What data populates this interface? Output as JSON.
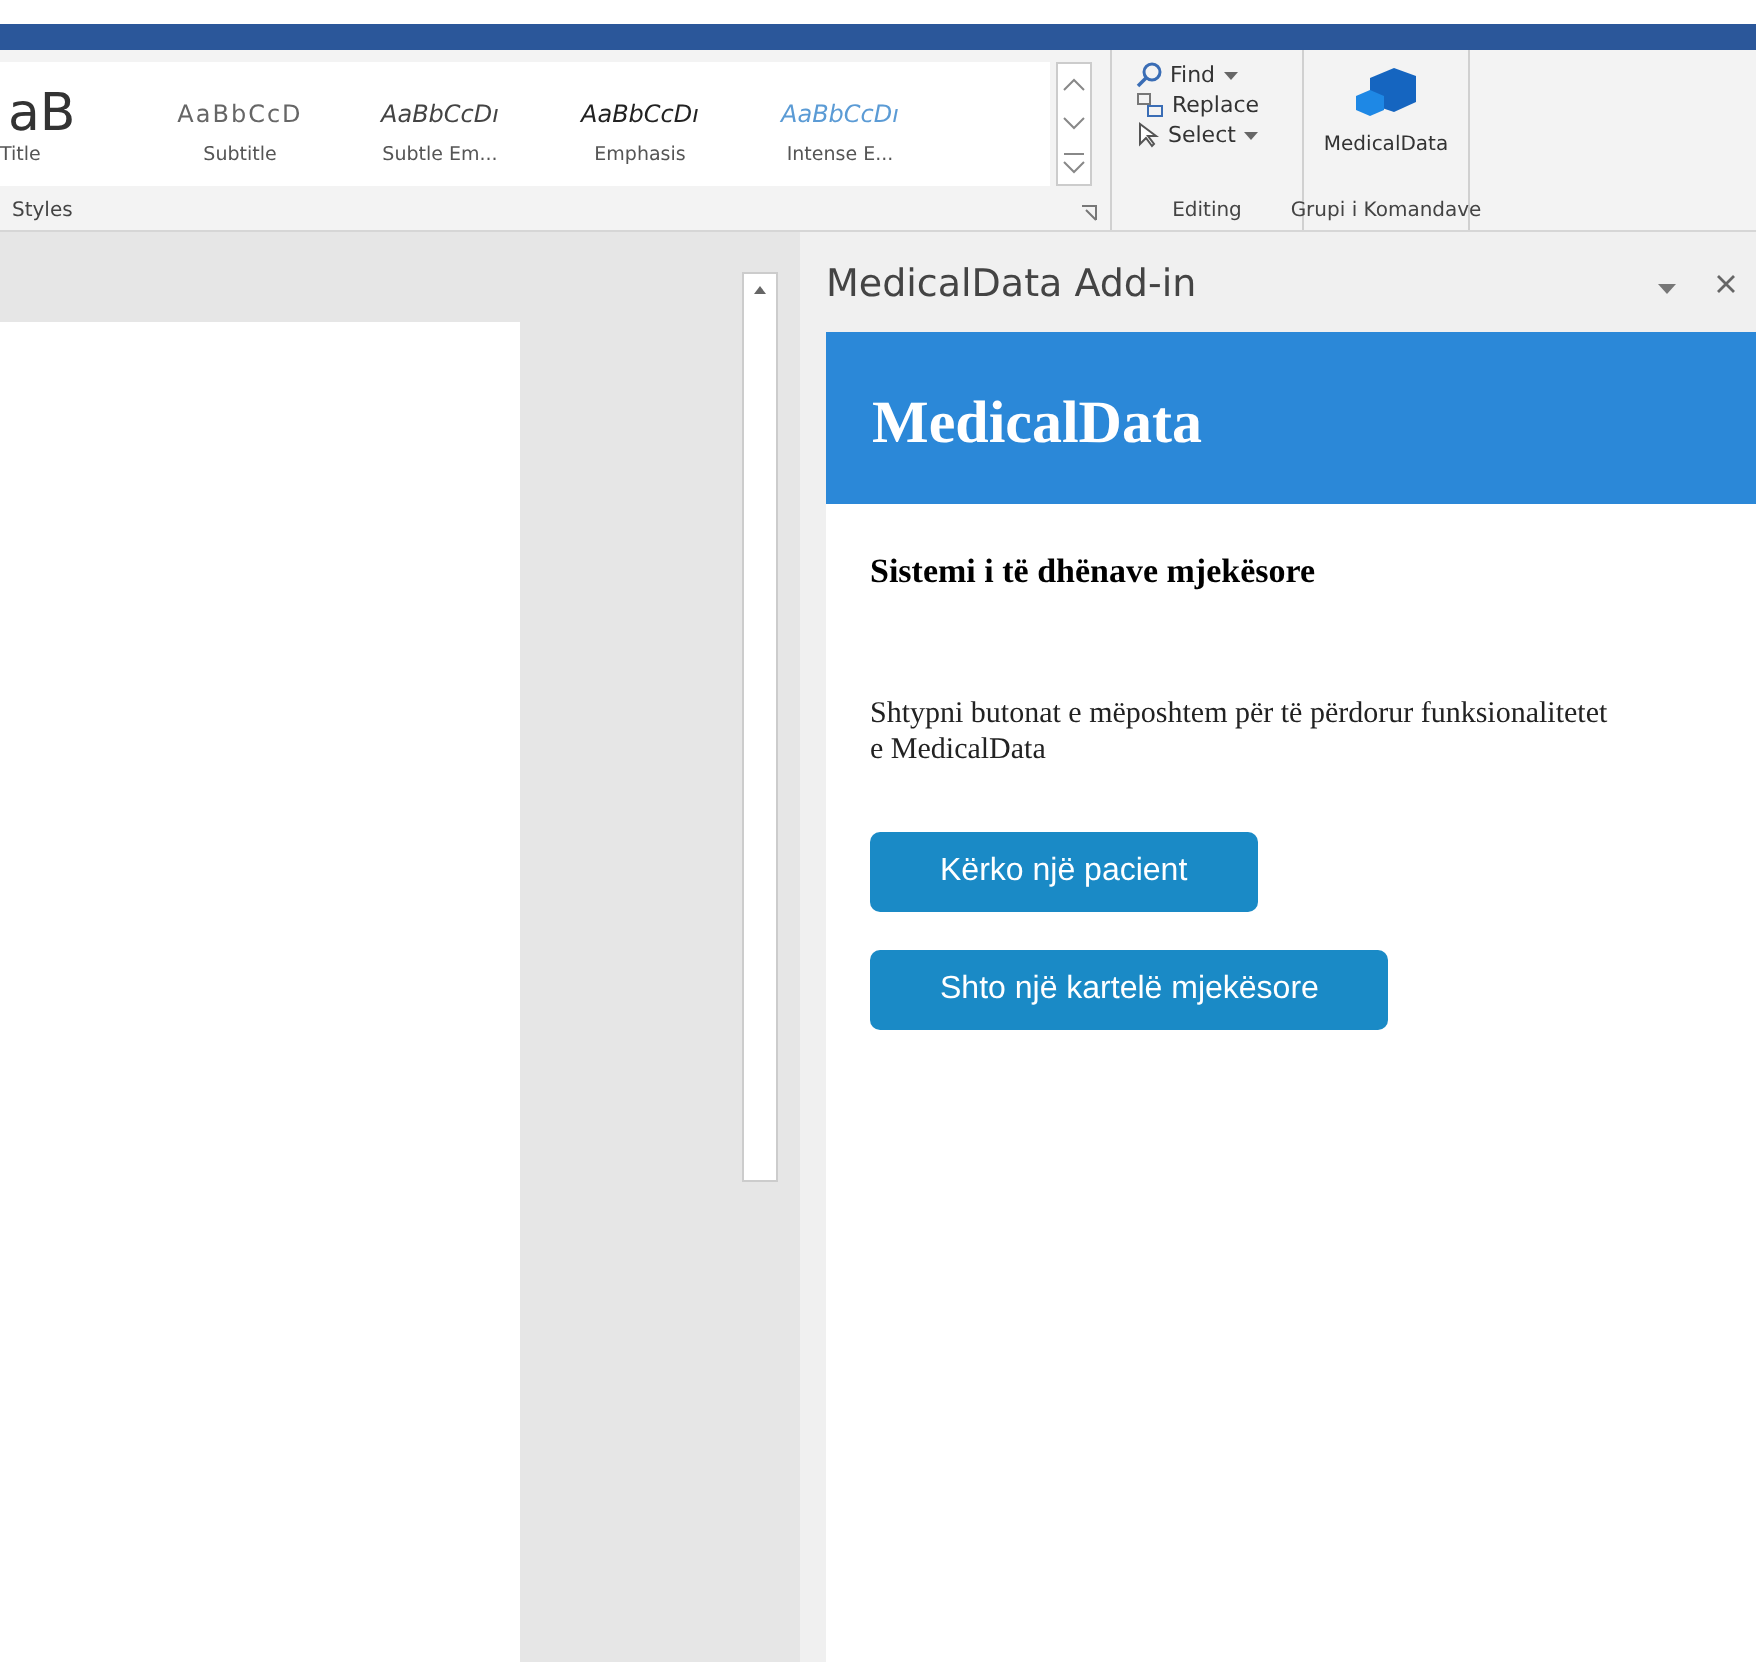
{
  "ribbon": {
    "styles": [
      {
        "preview": "aB",
        "label": "Title",
        "kind": "title"
      },
      {
        "preview": "AaBbCcD",
        "label": "Subtitle",
        "kind": "subtitle"
      },
      {
        "preview": "AaBbCcDı",
        "label": "Subtle Em...",
        "kind": "subtle"
      },
      {
        "preview": "AaBbCcDı",
        "label": "Emphasis",
        "kind": "emphasis"
      },
      {
        "preview": "AaBbCcDı",
        "label": "Intense E...",
        "kind": "intense"
      }
    ],
    "styles_group": "Styles",
    "editing": {
      "items": [
        {
          "label": "Find",
          "kind": "find",
          "dropdown": true
        },
        {
          "label": "Replace",
          "kind": "replace",
          "dropdown": false
        },
        {
          "label": "Select",
          "kind": "select",
          "dropdown": true
        }
      ],
      "group": "Editing"
    },
    "addin": {
      "label": "MedicalData",
      "group": "Grupi i Komandave"
    }
  },
  "task_pane": {
    "title": "MedicalData Add-in",
    "header": "MedicalData",
    "subtitle": "Sistemi i të dhënave mjekësore",
    "description": "Shtypni butonat e mëposhtem për të përdorur funksionalitetet e MedicalData",
    "buttons": [
      "Kërko një pacient",
      "Shto një kartelë mjekësore"
    ]
  }
}
